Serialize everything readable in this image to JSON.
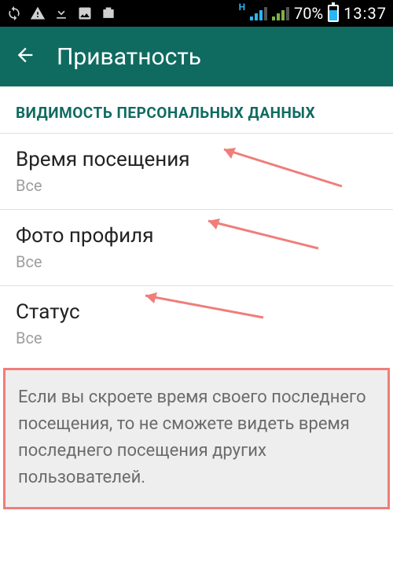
{
  "status": {
    "battery_percent": "70%",
    "time": "13:37",
    "net_letter": "H"
  },
  "app_bar": {
    "title": "Приватность"
  },
  "section_header": "ВИДИМОСТЬ ПЕРСОНАЛЬНЫХ ДАННЫХ",
  "settings": {
    "last_seen": {
      "title": "Время посещения",
      "value": "Все"
    },
    "profile_photo": {
      "title": "Фото профиля",
      "value": "Все"
    },
    "status": {
      "title": "Статус",
      "value": "Все"
    }
  },
  "info_text": "Если вы скроете время своего последнего посещения, то не сможете видеть время последнего посещения других пользователей."
}
